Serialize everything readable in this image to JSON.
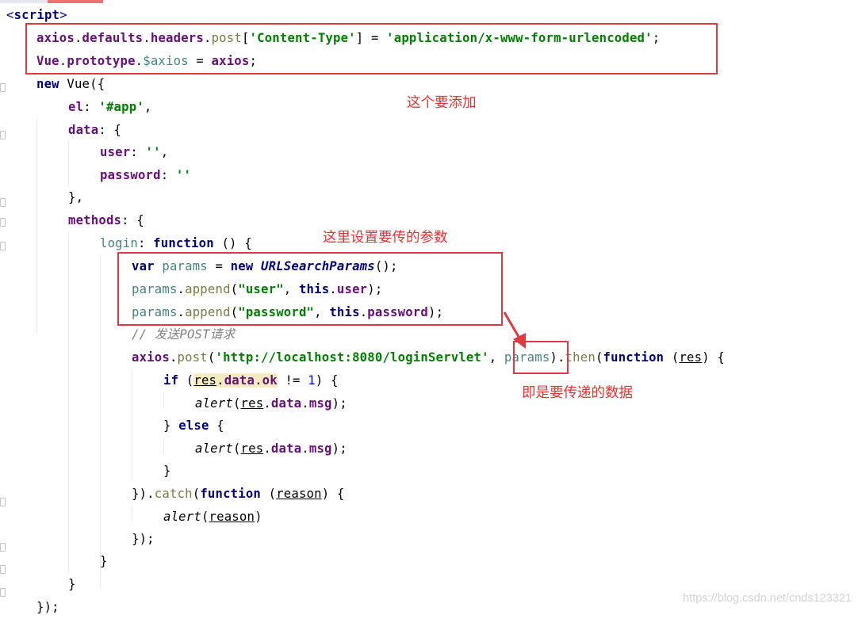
{
  "editor": {
    "language": "vue/javascript",
    "lines": [
      [
        [
          "<",
          "hl-tag"
        ],
        [
          "script",
          "kw"
        ],
        [
          ">",
          "hl-tag"
        ]
      ],
      [
        [
          "axios",
          "id-bold"
        ],
        [
          ".",
          "punc"
        ],
        [
          "defaults",
          "id-bold"
        ],
        [
          ".",
          "punc"
        ],
        [
          "headers",
          "id-bold"
        ],
        [
          ".",
          "punc"
        ],
        [
          "post",
          "method"
        ],
        [
          "[",
          "punc"
        ],
        [
          "'Content-Type'",
          "str"
        ],
        [
          "] = ",
          "punc"
        ],
        [
          "'application/x-www-form-urlencoded'",
          "str"
        ],
        [
          ";",
          "punc"
        ]
      ],
      [
        [
          "Vue",
          "id-bold"
        ],
        [
          ".",
          "punc"
        ],
        [
          "prototype",
          "id-bold"
        ],
        [
          ".",
          "punc"
        ],
        [
          "$axios",
          "var"
        ],
        [
          " = ",
          "punc"
        ],
        [
          "axios",
          "id-bold"
        ],
        [
          ";",
          "punc"
        ]
      ],
      [
        [
          "new ",
          "kw"
        ],
        [
          "Vue",
          "id"
        ],
        [
          "({",
          "punc"
        ]
      ],
      [
        [
          "el",
          "prop"
        ],
        [
          ": ",
          "punc"
        ],
        [
          "'#app'",
          "str"
        ],
        [
          ",",
          "punc"
        ]
      ],
      [
        [
          "data",
          "prop"
        ],
        [
          ": {",
          "punc"
        ]
      ],
      [
        [
          "user",
          "prop"
        ],
        [
          ": ",
          "punc"
        ],
        [
          "''",
          "str"
        ],
        [
          ",",
          "punc"
        ]
      ],
      [
        [
          "password",
          "prop"
        ],
        [
          ": ",
          "punc"
        ],
        [
          "''",
          "str"
        ]
      ],
      [
        [
          "},",
          "punc"
        ]
      ],
      [
        [
          "methods",
          "prop"
        ],
        [
          ": {",
          "punc"
        ]
      ],
      [
        [
          "login",
          "var"
        ],
        [
          ": ",
          "punc"
        ],
        [
          "function ",
          "kw"
        ],
        [
          "() {",
          "punc"
        ]
      ],
      [
        [
          "var ",
          "kw"
        ],
        [
          "params",
          "var"
        ],
        [
          " = ",
          "punc"
        ],
        [
          "new ",
          "kw"
        ],
        [
          "URLSearchParams",
          "italic-cls"
        ],
        [
          "();",
          "punc"
        ]
      ],
      [
        [
          "params",
          "var"
        ],
        [
          ".",
          "punc"
        ],
        [
          "append",
          "method"
        ],
        [
          "(",
          "punc"
        ],
        [
          "\"user\"",
          "str"
        ],
        [
          ", ",
          "punc"
        ],
        [
          "this",
          "kw"
        ],
        [
          ".",
          "punc"
        ],
        [
          "user",
          "prop"
        ],
        [
          ");",
          "punc"
        ]
      ],
      [
        [
          "params",
          "var"
        ],
        [
          ".",
          "punc"
        ],
        [
          "append",
          "method"
        ],
        [
          "(",
          "punc"
        ],
        [
          "\"password\"",
          "str"
        ],
        [
          ", ",
          "punc"
        ],
        [
          "this",
          "kw"
        ],
        [
          ".",
          "punc"
        ],
        [
          "password",
          "prop"
        ],
        [
          ");",
          "punc"
        ]
      ],
      [
        [
          "// 发送POST请求",
          "cmt"
        ]
      ],
      [
        [
          "axios",
          "id-bold"
        ],
        [
          ".",
          "punc"
        ],
        [
          "post",
          "method"
        ],
        [
          "(",
          "punc"
        ],
        [
          "'http://localhost:8080/loginServlet'",
          "str"
        ],
        [
          ", ",
          "punc"
        ],
        [
          "params",
          "var"
        ],
        [
          ").",
          "punc"
        ],
        [
          "then",
          "method"
        ],
        [
          "(",
          "punc"
        ],
        [
          "function ",
          "kw"
        ],
        [
          "(",
          "punc"
        ],
        [
          "res",
          "param"
        ],
        [
          ") {",
          "punc"
        ]
      ],
      [
        [
          "if ",
          "kw"
        ],
        [
          "(",
          "punc"
        ],
        [
          "res",
          "param-hl"
        ],
        [
          ".",
          "punc-hl"
        ],
        [
          "data",
          "prop-hl"
        ],
        [
          ".",
          "punc-hl"
        ],
        [
          "ok",
          "prop-hl"
        ],
        [
          " != ",
          "punc"
        ],
        [
          "1",
          "num"
        ],
        [
          ") {",
          "punc"
        ]
      ],
      [
        [
          "alert",
          "alert-fn"
        ],
        [
          "(",
          "punc"
        ],
        [
          "res",
          "param"
        ],
        [
          ".",
          "punc"
        ],
        [
          "data",
          "prop"
        ],
        [
          ".",
          "punc"
        ],
        [
          "msg",
          "prop"
        ],
        [
          ");",
          "punc"
        ]
      ],
      [
        [
          "} ",
          "punc"
        ],
        [
          "else ",
          "kw"
        ],
        [
          "{",
          "punc"
        ]
      ],
      [
        [
          "alert",
          "alert-fn"
        ],
        [
          "(",
          "punc"
        ],
        [
          "res",
          "param"
        ],
        [
          ".",
          "punc"
        ],
        [
          "data",
          "prop"
        ],
        [
          ".",
          "punc"
        ],
        [
          "msg",
          "prop"
        ],
        [
          ");",
          "punc"
        ]
      ],
      [
        [
          "}",
          "punc"
        ]
      ],
      [
        [
          "}).",
          "punc"
        ],
        [
          "catch",
          "method"
        ],
        [
          "(",
          "punc"
        ],
        [
          "function ",
          "kw"
        ],
        [
          "(",
          "punc"
        ],
        [
          "reason",
          "param"
        ],
        [
          ") {",
          "punc"
        ]
      ],
      [
        [
          "alert",
          "alert-fn"
        ],
        [
          "(",
          "punc"
        ],
        [
          "reason",
          "param"
        ],
        [
          ")",
          "punc"
        ]
      ],
      [
        [
          "});",
          "punc"
        ]
      ],
      [
        [
          "}",
          "punc"
        ]
      ],
      [
        [
          "}",
          "punc"
        ]
      ],
      [
        [
          "});",
          "punc"
        ]
      ]
    ]
  },
  "annotations": {
    "note_add": "这个要添加",
    "note_params": "这里设置要传的参数",
    "note_data": "即是要传递的数据"
  },
  "watermark": "https://blog.csdn.net/cnds123321",
  "colors": {
    "annotation_red": "#e0393e",
    "keyword": "#000080",
    "string": "#008000",
    "property": "#660e7a",
    "comment": "#808080"
  }
}
